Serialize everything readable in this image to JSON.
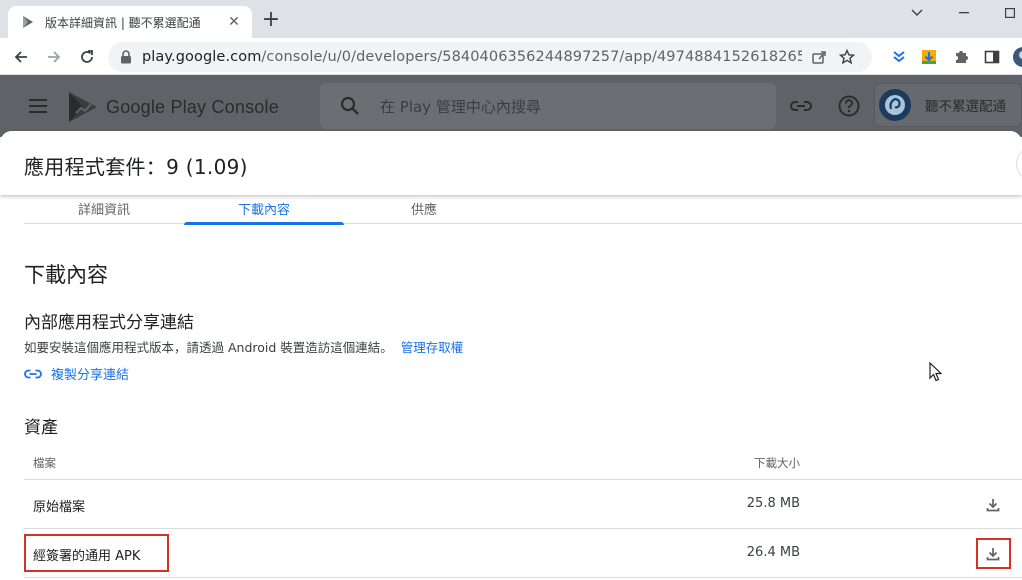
{
  "browser": {
    "tab_title": "版本詳細資訊 | 聽不累選配通",
    "new_tab_label": "+",
    "url_host": "play.google.com",
    "url_path": "/console/u/0/developers/5840406356244897257/app/4974884152618265591/tra..."
  },
  "console": {
    "logo_text": "Google Play Console",
    "search_placeholder": "在 Play 管理中心內搜尋",
    "account_name": "聽不累選配通"
  },
  "sheet": {
    "title": "應用程式套件：9 (1.09)"
  },
  "tabs": [
    {
      "label": "詳細資訊"
    },
    {
      "label": "下載內容"
    },
    {
      "label": "供應"
    }
  ],
  "downloads": {
    "section_title": "下載內容",
    "share": {
      "title": "內部應用程式分享連結",
      "description": "如要安裝這個應用程式版本，請透過 Android 裝置造訪這個連結。",
      "manage_link": "管理存取權",
      "copy_label": "複製分享連結"
    },
    "assets": {
      "title": "資產",
      "col_file": "檔案",
      "col_size": "下載大小",
      "rows": [
        {
          "name": "原始檔案",
          "size": "25.8 MB"
        },
        {
          "name": "經簽署的通用 APK",
          "size": "26.4 MB"
        }
      ]
    }
  },
  "colors": {
    "accent": "#1a73e8",
    "highlight": "#d93025",
    "scrim": "#5f6368"
  }
}
